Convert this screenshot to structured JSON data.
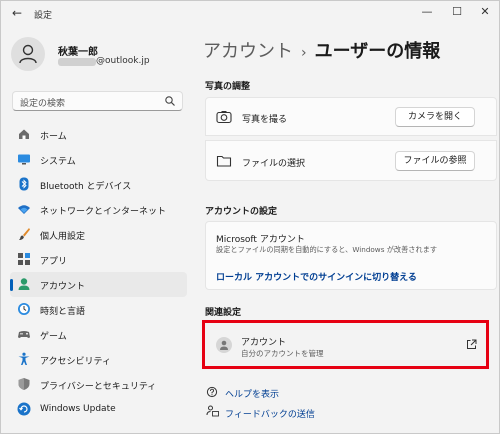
{
  "window": {
    "title": "設定",
    "back_glyph": "←",
    "minimize_glyph": "—",
    "maximize_glyph": "☐",
    "close_glyph": "✕"
  },
  "profile": {
    "name": "秋葉一郎",
    "email_visible": "@outlook.jp"
  },
  "search": {
    "placeholder": "設定の検索"
  },
  "nav": [
    {
      "label": "ホーム",
      "icon": "home-icon"
    },
    {
      "label": "システム",
      "icon": "system-icon"
    },
    {
      "label": "Bluetooth とデバイス",
      "icon": "bluetooth-icon"
    },
    {
      "label": "ネットワークとインターネット",
      "icon": "wifi-icon"
    },
    {
      "label": "個人用設定",
      "icon": "brush-icon"
    },
    {
      "label": "アプリ",
      "icon": "apps-icon"
    },
    {
      "label": "アカウント",
      "icon": "account-icon",
      "active": true
    },
    {
      "label": "時刻と言語",
      "icon": "time-language-icon"
    },
    {
      "label": "ゲーム",
      "icon": "gaming-icon"
    },
    {
      "label": "アクセシビリティ",
      "icon": "accessibility-icon"
    },
    {
      "label": "プライバシーとセキュリティ",
      "icon": "shield-icon"
    },
    {
      "label": "Windows Update",
      "icon": "update-icon"
    }
  ],
  "breadcrumb": {
    "parent": "アカウント",
    "separator": "›",
    "current": "ユーザーの情報"
  },
  "photo": {
    "title": "写真の調整",
    "take_label": "写真を撮る",
    "take_button": "カメラを開く",
    "choose_label": "ファイルの選択",
    "choose_button": "ファイルの参照"
  },
  "account_settings": {
    "title": "アカウントの設定",
    "ms_title": "Microsoft アカウント",
    "ms_subtitle": "設定とファイルの同期を自動的にすると、Windows が改善されます",
    "local_link": "ローカル アカウントでのサインインに切り替える"
  },
  "related": {
    "title": "関連設定",
    "item_title": "アカウント",
    "item_subtitle": "自分のアカウントを管理"
  },
  "help": {
    "help_label": "ヘルプを表示",
    "feedback_label": "フィードバックの送信"
  },
  "colors": {
    "accent": "#005fb8",
    "link": "#003e92",
    "highlight": "#e60012"
  }
}
